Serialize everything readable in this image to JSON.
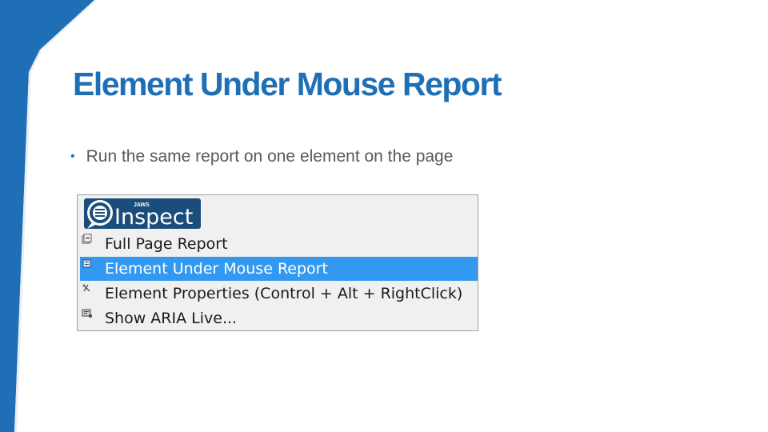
{
  "slide": {
    "title": "Element Under Mouse Report",
    "bullets": [
      {
        "text": "Run the same report on one element on the page"
      }
    ],
    "accent_color": "#1f6fb6"
  },
  "menu": {
    "logo": {
      "brand_text": "Inspect",
      "small_text": "JAWS"
    },
    "items": [
      {
        "label": "Full Page Report",
        "icon": "report-icon",
        "selected": false
      },
      {
        "label": "Element Under Mouse Report",
        "icon": "element-report-icon",
        "selected": true
      },
      {
        "label": "Element Properties (Control + Alt + RightClick)",
        "icon": "properties-icon",
        "selected": false
      },
      {
        "label": "Show ARIA Live...",
        "icon": "aria-live-icon",
        "selected": false
      }
    ],
    "selection_color": "#3399f0"
  }
}
